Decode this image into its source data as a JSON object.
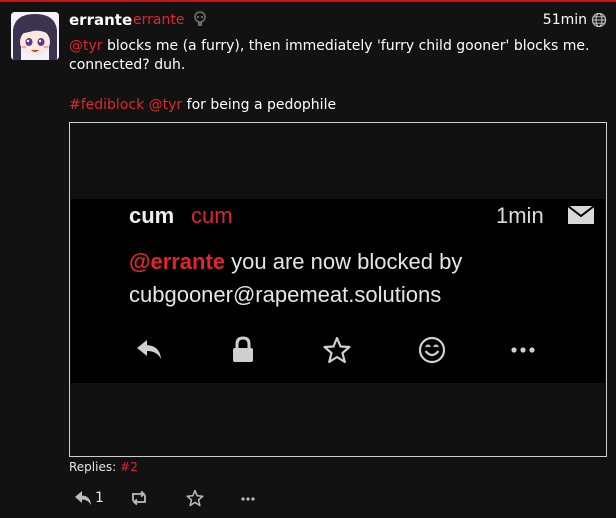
{
  "status": {
    "author_name": "errante",
    "author_handle": "errante",
    "time": "51min",
    "body_line1": "blocks me (a furry), then immediately 'furry child gooner' blocks me. connected? duh.",
    "mention1": "@tyr",
    "hashtag": "#fediblock",
    "mention2": "@tyr",
    "body_line2_suffix": " for being a pedophile",
    "replies_label": "Replies:",
    "replies_ref": "#2",
    "reply_count": "1"
  },
  "attachment": {
    "name": "cum",
    "handle": "cum",
    "time": "1min",
    "mention": "@errante",
    "text_after_mention": " you are now blocked by",
    "text_line2": "cubgooner@rapemeat.solutions"
  },
  "icons": {
    "bot": "bot-icon",
    "visibility": "globe-icon",
    "mail": "envelope-icon",
    "reply": "reply-icon",
    "repeat": "repeat-icon",
    "favorite": "star-icon",
    "more": "ellipsis-icon",
    "lock": "lock-icon",
    "emoji": "smiley-icon"
  },
  "colors": {
    "accent": "#e0262a",
    "background": "#121212",
    "text": "#e6e6e6"
  }
}
